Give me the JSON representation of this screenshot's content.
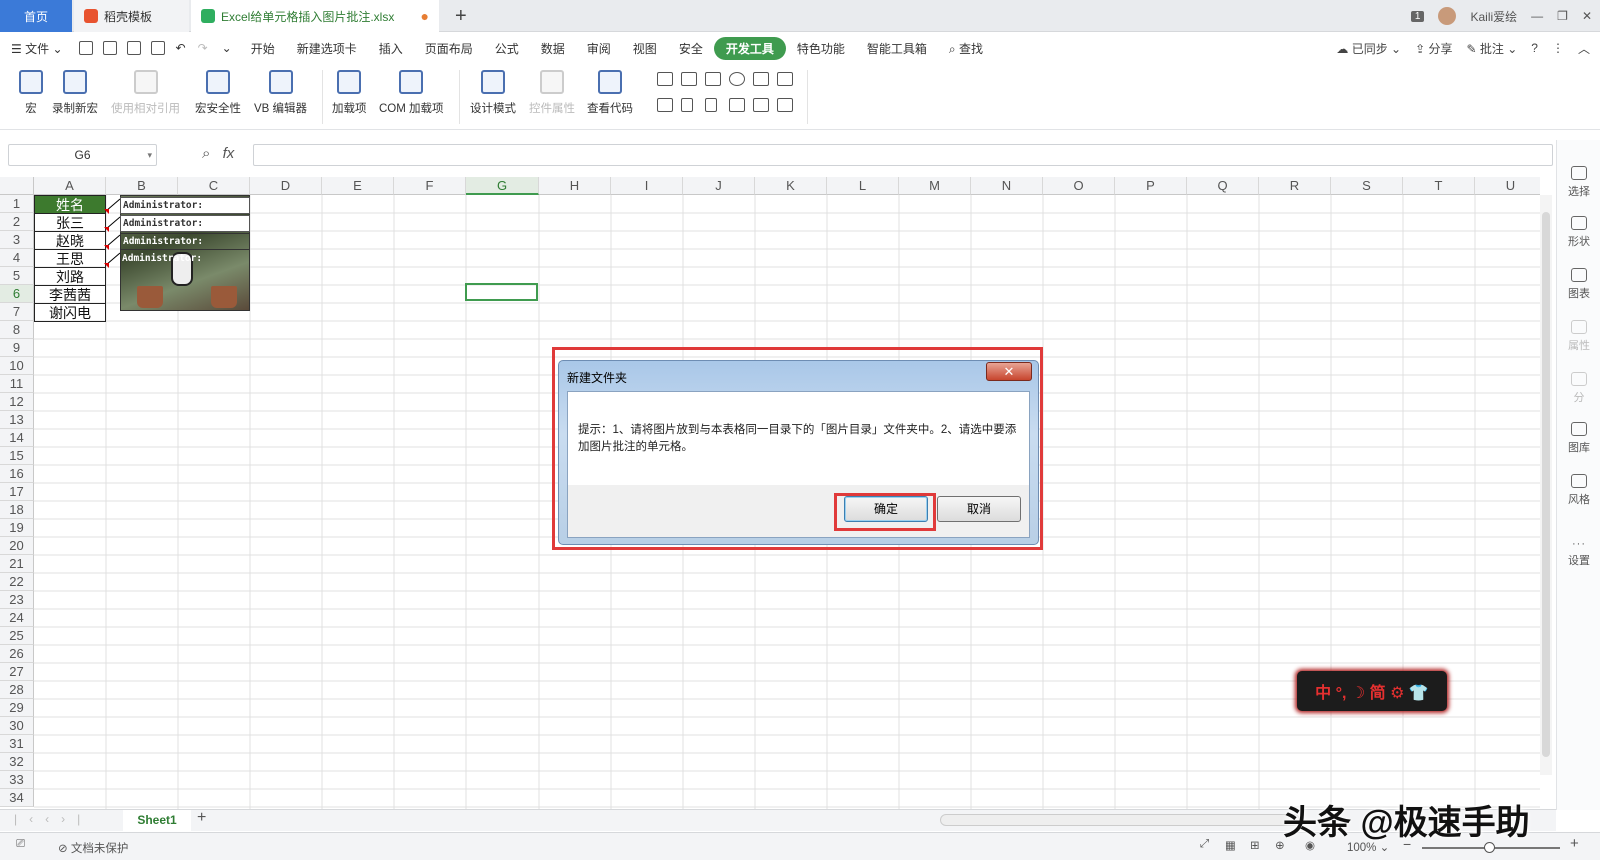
{
  "titlebar": {
    "tabs": [
      {
        "label": "首页"
      },
      {
        "label": "稻壳模板"
      },
      {
        "label": "Excel给单元格插入图片批注.xlsx"
      }
    ],
    "window_count": "1",
    "user": "Kaili爱绘"
  },
  "menu": {
    "file": "文件",
    "items": [
      "开始",
      "新建选项卡",
      "插入",
      "页面布局",
      "公式",
      "数据",
      "审阅",
      "视图",
      "安全",
      "开发工具",
      "特色功能",
      "智能工具箱",
      "查找"
    ],
    "active": "开发工具",
    "right": [
      "已同步",
      "分享",
      "批注"
    ]
  },
  "ribbon": {
    "buttons": [
      {
        "label": "宏",
        "enabled": true
      },
      {
        "label": "录制新宏",
        "enabled": true
      },
      {
        "label": "使用相对引用",
        "enabled": false
      },
      {
        "label": "宏安全性",
        "enabled": true
      },
      {
        "label": "VB 编辑器",
        "enabled": true
      },
      {
        "label": "加载项",
        "enabled": true
      },
      {
        "label": "COM 加载项",
        "enabled": true
      },
      {
        "label": "设计模式",
        "enabled": true
      },
      {
        "label": "控件属性",
        "enabled": false
      },
      {
        "label": "查看代码",
        "enabled": true
      }
    ]
  },
  "formula_bar": {
    "name_box": "G6",
    "fx": "fx",
    "value": ""
  },
  "sheet": {
    "columns": [
      "A",
      "B",
      "C",
      "D",
      "E",
      "F",
      "G",
      "H",
      "I",
      "J",
      "K",
      "L",
      "M",
      "N",
      "O",
      "P",
      "Q",
      "R",
      "S",
      "T",
      "U"
    ],
    "selected_column": "G",
    "rows": [
      "1",
      "2",
      "3",
      "4",
      "5",
      "6",
      "7",
      "8",
      "9",
      "10",
      "11",
      "12",
      "13",
      "14",
      "15",
      "16",
      "17",
      "18",
      "19",
      "20",
      "21",
      "22",
      "23",
      "24",
      "25",
      "26",
      "27",
      "28",
      "29",
      "30",
      "31",
      "32",
      "33",
      "34"
    ],
    "selected_row": "6",
    "col_a_values": [
      "姓名",
      "张三",
      "赵晓",
      "王思",
      "刘路",
      "李茜茜",
      "谢闪电"
    ],
    "comment_author": "Administrator:"
  },
  "dialog": {
    "title": "新建文件夹",
    "close": "✕",
    "message": "提示：1、请将图片放到与本表格同一目录下的「图片目录」文件夹中。2、请选中要添加图片批注的单元格。",
    "ok": "确定",
    "cancel": "取消"
  },
  "ime": {
    "text": "中 °, ☽ 简 ⚙ 👕"
  },
  "sidebar": {
    "items": [
      {
        "label": "选择",
        "enabled": true
      },
      {
        "label": "形状",
        "enabled": true
      },
      {
        "label": "图表",
        "enabled": true
      },
      {
        "label": "属性",
        "enabled": false
      },
      {
        "label": "分",
        "enabled": false
      },
      {
        "label": "图库",
        "enabled": true
      },
      {
        "label": "风格",
        "enabled": true
      },
      {
        "label": "设置",
        "enabled": true
      }
    ]
  },
  "sheet_tabs": {
    "active": "Sheet1"
  },
  "status": {
    "doc_protect": "文档未保护",
    "zoom": "100%"
  },
  "watermark": "头条 @极速手助"
}
